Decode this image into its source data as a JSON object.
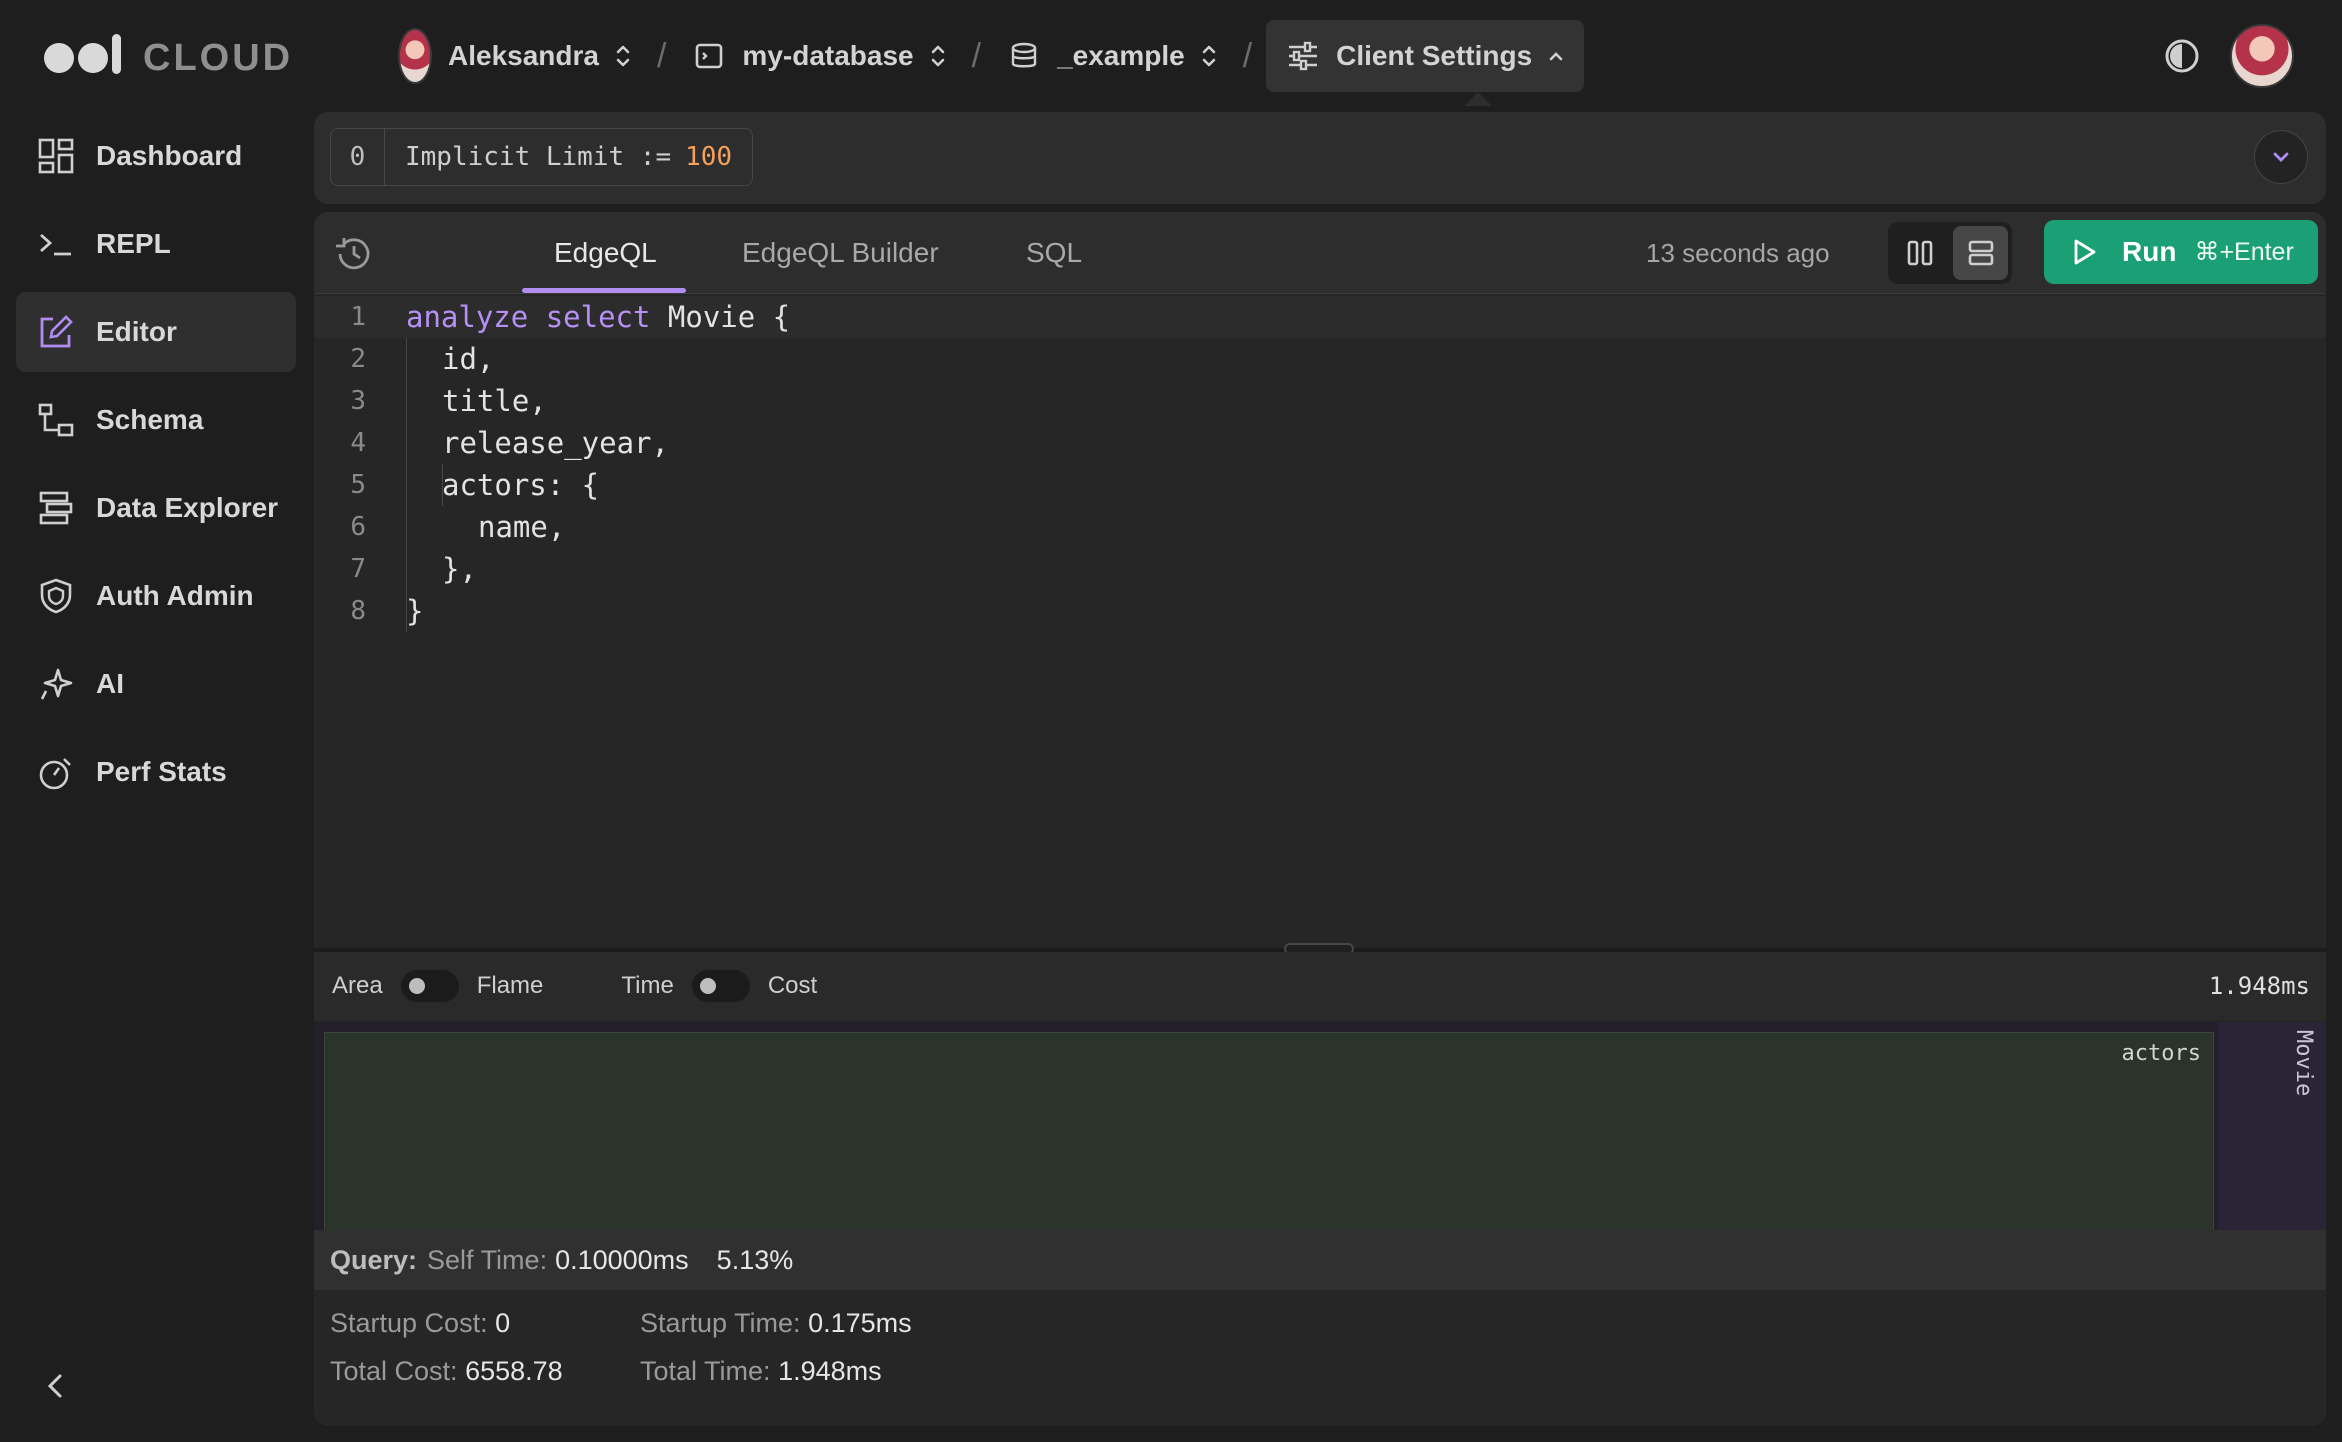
{
  "logo": {
    "text": "CLOUD"
  },
  "breadcrumbs": {
    "user": "Aleksandra",
    "instance": "my-database",
    "database": "_example",
    "settings": "Client Settings"
  },
  "sidebar": {
    "items": [
      {
        "label": "Dashboard",
        "icon": "dashboard-icon"
      },
      {
        "label": "REPL",
        "icon": "terminal-icon"
      },
      {
        "label": "Editor",
        "icon": "edit-icon"
      },
      {
        "label": "Schema",
        "icon": "schema-icon"
      },
      {
        "label": "Data Explorer",
        "icon": "data-explorer-icon"
      },
      {
        "label": "Auth Admin",
        "icon": "shield-icon"
      },
      {
        "label": "AI",
        "icon": "sparkle-icon"
      },
      {
        "label": "Perf Stats",
        "icon": "stopwatch-icon"
      }
    ],
    "active": "Editor"
  },
  "settings_bar": {
    "chip_count": "0",
    "limit_label": "Implicit Limit :=",
    "limit_value": "100"
  },
  "editor": {
    "tabs": [
      "EdgeQL",
      "EdgeQL Builder",
      "SQL"
    ],
    "active_tab": "EdgeQL",
    "last_run": "13 seconds ago",
    "run_label": "Run",
    "run_shortcut": "⌘+Enter",
    "line_numbers": [
      "1",
      "2",
      "3",
      "4",
      "5",
      "6",
      "7",
      "8"
    ],
    "code": {
      "l1_kw1": "analyze",
      "l1_kw2": "select",
      "l1_rest": "Movie {",
      "l2": "id,",
      "l3": "title,",
      "l4": "release_year,",
      "l5": "actors: {",
      "l6": "name,",
      "l7": "},",
      "l8": "}"
    }
  },
  "analyze": {
    "toggle1_left": "Area",
    "toggle1_right": "Flame",
    "toggle2_left": "Time",
    "toggle2_right": "Cost",
    "total_time": "1.948ms",
    "flame": {
      "actors_label": "actors",
      "movie_label": "Movie"
    },
    "stats": {
      "head_label": "Query:",
      "self_time_label": "Self Time:",
      "self_time_value": "0.10000ms",
      "self_time_pct": "5.13%",
      "startup_cost_label": "Startup Cost:",
      "startup_cost_value": "0",
      "total_cost_label": "Total Cost:",
      "total_cost_value": "6558.78",
      "startup_time_label": "Startup Time:",
      "startup_time_value": "0.175ms",
      "total_time_label": "Total Time:",
      "total_time_value": "1.948ms"
    }
  },
  "colors": {
    "accent_purple": "#b18cf2",
    "run_green": "#1b9f74",
    "limit_orange": "#f3a05b"
  }
}
